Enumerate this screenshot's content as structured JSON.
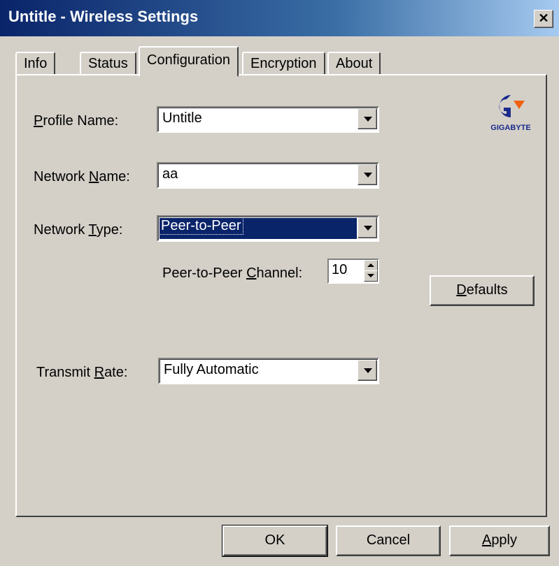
{
  "window": {
    "title": "Untitle - Wireless Settings",
    "close_label": "✕"
  },
  "tabs": [
    {
      "label": "Info"
    },
    {
      "label": "Status"
    },
    {
      "label": "Configuration"
    },
    {
      "label": "Encryption"
    },
    {
      "label": "About"
    }
  ],
  "active_tab": "Configuration",
  "logo": {
    "text": "GIGABYTE",
    "colors": {
      "mark": "#1a2a8c",
      "accent": "#f06010"
    }
  },
  "form": {
    "profile_name": {
      "label_pre": "",
      "label_u": "P",
      "label_post": "rofile Name:",
      "value": "Untitle"
    },
    "network_name": {
      "label_pre": "Network ",
      "label_u": "N",
      "label_post": "ame:",
      "value": "aa"
    },
    "network_type": {
      "label_pre": "Network ",
      "label_u": "T",
      "label_post": "ype:",
      "value": "Peer-to-Peer"
    },
    "channel": {
      "label_pre": "Peer-to-Peer ",
      "label_u": "C",
      "label_post": "hannel:",
      "value": "10"
    },
    "transmit_rate": {
      "label_pre": "Transmit ",
      "label_u": "R",
      "label_post": "ate:",
      "value": "Fully Automatic"
    }
  },
  "buttons": {
    "defaults_u": "D",
    "defaults_rest": "efaults",
    "ok": "OK",
    "cancel": "Cancel",
    "apply_u": "A",
    "apply_rest": "pply"
  },
  "colors": {
    "title_bar": "#0a246a",
    "face": "#d4d0c8",
    "selection": "#0a246a"
  }
}
